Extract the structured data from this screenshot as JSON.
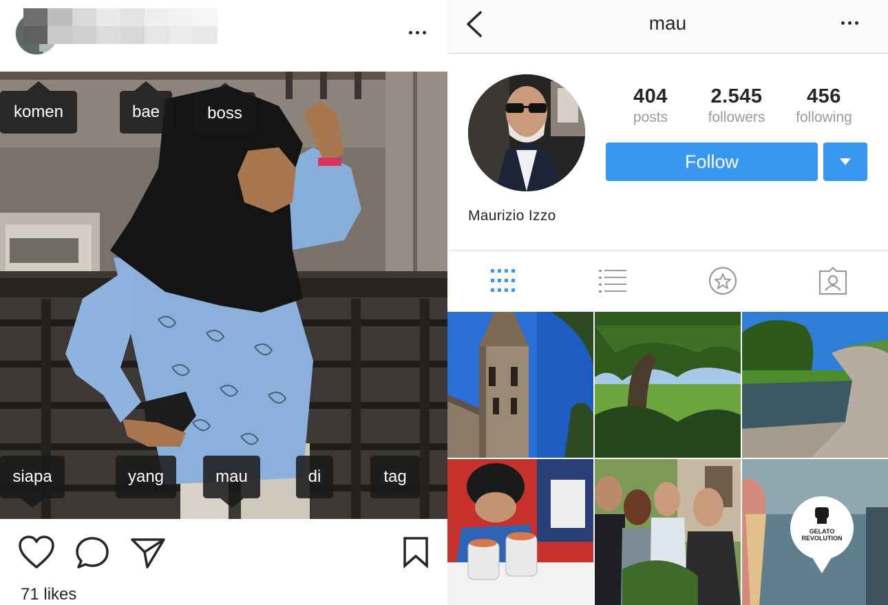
{
  "post": {
    "tags": {
      "t1": "komen",
      "t2": "bae",
      "t3": "boss",
      "t4": "siapa",
      "t5": "yang",
      "t6": "mau",
      "t7": "di",
      "t8": "tag"
    },
    "likes": "71 likes"
  },
  "profile": {
    "username": "mau",
    "stats": {
      "posts_count": "404",
      "posts_label": "posts",
      "followers_count": "2.545",
      "followers_label": "followers",
      "following_count": "456",
      "following_label": "following"
    },
    "follow_label": "Follow",
    "full_name": "Maurizio Izzo",
    "grid_badge": {
      "line1": "GELATO",
      "line2": "REVOLUTION"
    }
  },
  "colors": {
    "accent": "#3897f0",
    "tab_active": "#3897f0",
    "tab_inactive": "#999999",
    "tag_bg": "#191919"
  },
  "icons": {
    "more": "more-horizontal-icon",
    "back": "chevron-left-icon",
    "like": "heart-icon",
    "comment": "comment-bubble-icon",
    "share": "paper-plane-icon",
    "save": "bookmark-icon",
    "grid_view": "grid-icon",
    "list_view": "list-icon",
    "saved": "star-icon",
    "tagged": "tagged-person-icon"
  }
}
